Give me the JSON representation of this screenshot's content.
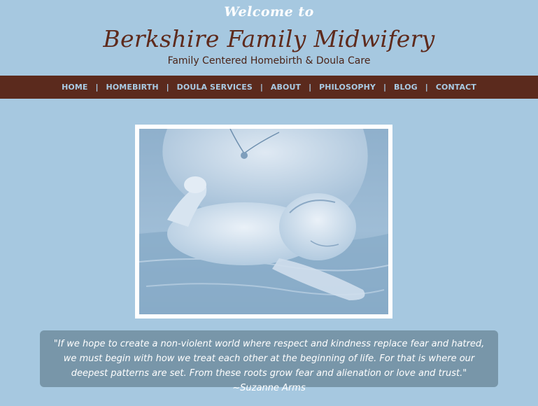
{
  "header": {
    "welcome": "Welcome to",
    "title": "Berkshire Family Midwifery",
    "tagline": "Family Centered Homebirth & Doula Care"
  },
  "nav": {
    "items": [
      "HOME",
      "HOMEBIRTH",
      "DOULA SERVICES",
      "ABOUT",
      "PHILOSOPHY",
      "BLOG",
      "CONTACT"
    ],
    "separator": "|"
  },
  "quote": {
    "text": "\"If we hope to create a non-violent world where respect and kindness replace fear and hatred, we must begin with how we treat each other at the beginning of life. For that is where our deepest patterns are set. From these roots grow fear and alienation or love and trust.\" ~Suzanne Arms"
  },
  "colors": {
    "background": "#a6c8e0",
    "nav_bar": "#5b2a1d",
    "title": "#5e2a1c",
    "quote_box": "#7896a9"
  }
}
